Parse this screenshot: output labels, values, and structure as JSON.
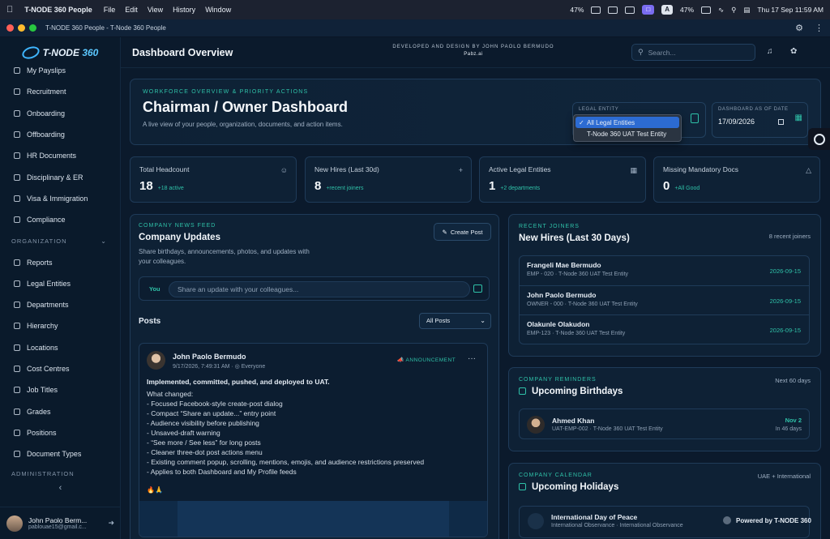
{
  "menubar": {
    "app_name": "T-NODE 360 People",
    "menus": [
      "File",
      "Edit",
      "View",
      "History",
      "Window"
    ],
    "battery1": "47%",
    "battery2": "47%",
    "input_badge": "A",
    "clock": "Thu 17 Sep  11:59 AM"
  },
  "window": {
    "title": "T-NODE 360 People - T-Node 360 People"
  },
  "sidebar": {
    "logo": {
      "prefix": "T-NODE",
      "suffix": " 360"
    },
    "items_top": [
      {
        "label": "My Payslips",
        "icon": "payslip-icon"
      },
      {
        "label": "Recruitment",
        "icon": "briefcase-icon"
      },
      {
        "label": "Onboarding",
        "icon": "user-plus-icon"
      },
      {
        "label": "Offboarding",
        "icon": "user-minus-icon"
      },
      {
        "label": "HR Documents",
        "icon": "document-icon"
      },
      {
        "label": "Disciplinary & ER",
        "icon": "scale-icon"
      },
      {
        "label": "Visa & Immigration",
        "icon": "plane-icon"
      },
      {
        "label": "Compliance",
        "icon": "file-check-icon"
      }
    ],
    "section_org": "ORGANIZATION",
    "items_org": [
      {
        "label": "Reports",
        "icon": "bar-chart-icon"
      },
      {
        "label": "Legal Entities",
        "icon": "building-icon"
      },
      {
        "label": "Departments",
        "icon": "sitemap-icon"
      },
      {
        "label": "Hierarchy",
        "icon": "hierarchy-icon"
      },
      {
        "label": "Locations",
        "icon": "map-pin-icon"
      },
      {
        "label": "Cost Centres",
        "icon": "store-icon"
      },
      {
        "label": "Job Titles",
        "icon": "id-badge-icon"
      },
      {
        "label": "Grades",
        "icon": "graduation-cap-icon"
      },
      {
        "label": "Positions",
        "icon": "target-icon"
      },
      {
        "label": "Document Types",
        "icon": "file-type-icon"
      }
    ],
    "section_admin": "ADMINISTRATION",
    "user": {
      "name": "John Paolo Berm...",
      "email": "pablouae15@gmail.c..."
    }
  },
  "header": {
    "title": "Dashboard Overview",
    "credit_line": "DEVELOPED AND DESIGN BY JOHN PAOLO BERMUDO",
    "credit_sub": "Pabz.ai",
    "search_placeholder": "Search..."
  },
  "hero": {
    "eyebrow": "WORKFORCE OVERVIEW & PRIORITY ACTIONS",
    "title": "Chairman / Owner Dashboard",
    "description": "A live view of your people, organization, documents, and action items.",
    "legal_entity_label": "LEGAL ENTITY",
    "legal_entity_options": [
      "All Legal Entities",
      "T-Node 360 UAT Test Entity"
    ],
    "legal_entity_selected": "All Legal Entities",
    "date_label": "DASHBOARD AS OF DATE",
    "date_value": "17/09/2026"
  },
  "stats": [
    {
      "label": "Total Headcount",
      "value": "18",
      "sub": "+18 active",
      "icon": "users-icon"
    },
    {
      "label": "New Hires (Last 30d)",
      "value": "8",
      "sub": "+recent joiners",
      "icon": "user-plus-icon"
    },
    {
      "label": "Active Legal Entities",
      "value": "1",
      "sub": "+2 departments",
      "icon": "building-icon"
    },
    {
      "label": "Missing Mandatory Docs",
      "value": "0",
      "sub": "+All Good",
      "icon": "warning-icon"
    }
  ],
  "news": {
    "eyebrow": "COMPANY NEWS FEED",
    "title": "Company Updates",
    "description": "Share birthdays, announcements, photos, and updates with your colleagues.",
    "create_post": "Create Post",
    "composer_you": "You",
    "composer_placeholder": "Share an update with your colleagues...",
    "posts_heading": "Posts",
    "filter_value": "All Posts",
    "post": {
      "author": "John Paolo Bermudo",
      "meta": "9/17/2026, 7:49:31 AM  ·  ◎ Everyone",
      "badge": "ANNOUNCEMENT",
      "headline": "Implemented, committed, pushed, and deployed to UAT.",
      "body": "What changed:\n- Focused Facebook-style create-post dialog\n- Compact “Share an update...” entry point\n- Audience visibility before publishing\n- Unsaved-draft warning\n- “See more / See less” for long posts\n- Cleaner three-dot post actions menu\n- Existing comment popup, scrolling, mentions, emojis, and audience restrictions preserved\n- Applies to both Dashboard and My Profile feeds",
      "emoji": "🔥🙏"
    }
  },
  "joiners": {
    "eyebrow": "RECENT JOINERS",
    "title": "New Hires (Last 30 Days)",
    "count": "8 recent joiners",
    "rows": [
      {
        "name": "Frangeli Mae Bermudo",
        "meta": "EMP - 020 · T-Node 360 UAT Test Entity",
        "date": "2026-09-15"
      },
      {
        "name": "John Paolo Bermudo",
        "meta": "OWNER - 000 · T-Node 360 UAT Test Entity",
        "date": "2026-09-15"
      },
      {
        "name": "Olakunle Olakudon",
        "meta": "EMP-123 · T-Node 360 UAT Test Entity",
        "date": "2026-09-15"
      }
    ]
  },
  "reminders": {
    "eyebrow": "COMPANY REMINDERS",
    "title": "Upcoming Birthdays",
    "range": "Next 60 days",
    "person": {
      "name": "Ahmed Khan",
      "meta": "UAT-EMP-002 · T-Node 360 UAT Test Entity",
      "date": "Nov 2",
      "in": "In 46 days"
    }
  },
  "calendar": {
    "eyebrow": "COMPANY CALENDAR",
    "title": "Upcoming Holidays",
    "scope": "UAE + International",
    "holiday": {
      "name": "International Day of Peace",
      "meta": "International Observance · International Observance"
    }
  },
  "footer": {
    "powered": "Powered by T-NODE 360"
  }
}
